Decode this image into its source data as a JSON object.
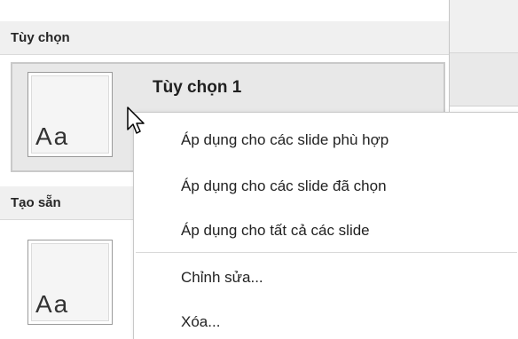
{
  "gallery": {
    "custom_header": "Tùy chọn",
    "builtin_header": "Tạo sẵn",
    "custom_item": {
      "title": "Tùy chọn 1",
      "thumb_text": "Aa"
    },
    "builtin_item": {
      "thumb_text": "Aa"
    }
  },
  "context_menu": {
    "items": [
      {
        "label": "Áp dụng cho các slide phù hợp"
      },
      {
        "label": "Áp dụng cho các slide đã chọn"
      },
      {
        "label": "Áp dụng cho tất cả các slide"
      },
      {
        "label": "Chỉnh sửa..."
      },
      {
        "label": "Xóa..."
      }
    ]
  },
  "colors": {
    "header_bg": "#f0f0f0",
    "selected_bg": "#e8e8e8",
    "menu_bg": "#ffffff",
    "text": "#222222"
  },
  "icons": {
    "cursor": "arrow-cursor-icon"
  }
}
